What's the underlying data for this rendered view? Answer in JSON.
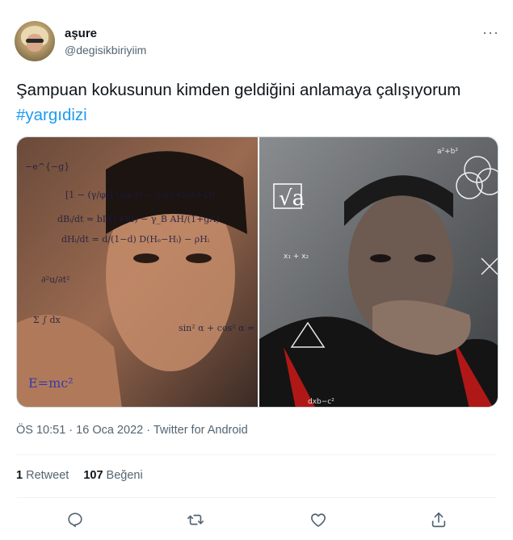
{
  "user": {
    "display_name": "aşure",
    "handle": "@degisikbiriyiim"
  },
  "more_label": "···",
  "tweet": {
    "text": "Şampuan kokusunun kimden geldiğini anlamaya çalışıyorum",
    "hashtag": "#yargıdizi"
  },
  "media": {
    "left_panel_text": "E=mc²",
    "right_panel_text": "√a"
  },
  "meta": {
    "time": "ÖS 10:51",
    "separator1": " · ",
    "date": "16 Oca 2022",
    "separator2": " · ",
    "source": "Twitter for Android"
  },
  "stats": {
    "retweets_count": "1",
    "retweets_label": "Retweet",
    "likes_count": "107",
    "likes_label": "Beğeni"
  },
  "actions": {
    "icons": [
      "reply-icon",
      "retweet-icon",
      "like-icon",
      "share-icon"
    ]
  },
  "colors": {
    "accent": "#1d9bf0",
    "secondary_text": "#536471",
    "border": "#eff3f4"
  }
}
